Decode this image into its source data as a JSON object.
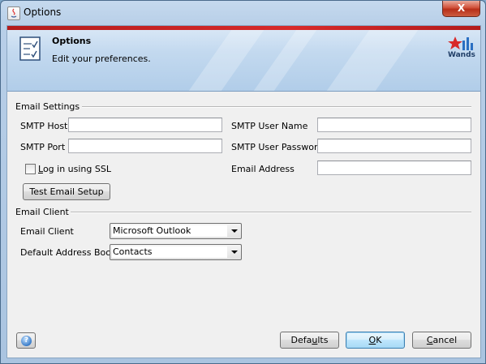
{
  "window": {
    "title": "Options",
    "close_glyph": "X"
  },
  "banner": {
    "title": "Options",
    "subtitle": "Edit your preferences.",
    "brand": "Wands",
    "accent_color": "#d82a2a"
  },
  "email_settings": {
    "section_label": "Email Settings",
    "smtp_host": {
      "label": "SMTP Host",
      "value": ""
    },
    "smtp_port": {
      "label": "SMTP Port",
      "value": ""
    },
    "ssl": {
      "label_underlined": "L",
      "label_rest": "og in using SSL",
      "checked": false
    },
    "test_button": "Test Email Setup",
    "smtp_user": {
      "label": "SMTP User Name",
      "value": ""
    },
    "smtp_password": {
      "label": "SMTP User Password",
      "value": ""
    },
    "email_address": {
      "label": "Email Address",
      "value": ""
    }
  },
  "email_client": {
    "section_label": "Email Client",
    "client": {
      "label": "Email Client",
      "selected": "Microsoft Outlook"
    },
    "address_book": {
      "label": "Default Address Book",
      "selected": "Contacts"
    }
  },
  "footer": {
    "help_icon": "question-mark",
    "defaults": {
      "underlined": "u",
      "before": "Defa",
      "after": "lts"
    },
    "ok": {
      "underlined": "O",
      "rest": "K"
    },
    "cancel": {
      "underlined": "C",
      "rest": "ancel"
    }
  }
}
